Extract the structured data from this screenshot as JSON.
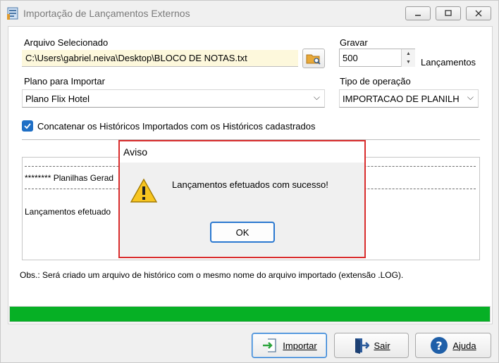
{
  "window": {
    "title": "Importação de Lançamentos Externos"
  },
  "form": {
    "arquivo_label": "Arquivo Selecionado",
    "arquivo_value": "C:\\Users\\gabriel.neiva\\Desktop\\BLOCO DE NOTAS.txt",
    "gravar_label": "Gravar",
    "gravar_value": "500",
    "gravar_suffix": "Lançamentos",
    "plano_label": "Plano para Importar",
    "plano_value": "Plano Flix Hotel",
    "tipo_label": "Tipo de operação",
    "tipo_value": "IMPORTACAO DE PLANILH",
    "concat_label": "Concatenar os Históricos Importados com os Históricos cadastrados",
    "concat_checked": true
  },
  "log": {
    "line1": "******** Planilhas Gerad",
    "line2": "Lançamentos efetuado"
  },
  "obs": "Obs.: Será criado um arquivo de histórico com o mesmo nome do arquivo importado (extensão .LOG).",
  "progress": {
    "percent": 100,
    "color": "#06b025"
  },
  "buttons": {
    "importar": "Importar",
    "sair": "Sair",
    "ajuda": "Ajuda"
  },
  "dialog": {
    "title": "Aviso",
    "message": "Lançamentos efetuados com sucesso!",
    "ok": "OK",
    "icon": "warning-icon"
  },
  "colors": {
    "accent": "#1f6fc5",
    "dialog_border": "#d92c2c",
    "file_bg": "#fdf8dc"
  }
}
